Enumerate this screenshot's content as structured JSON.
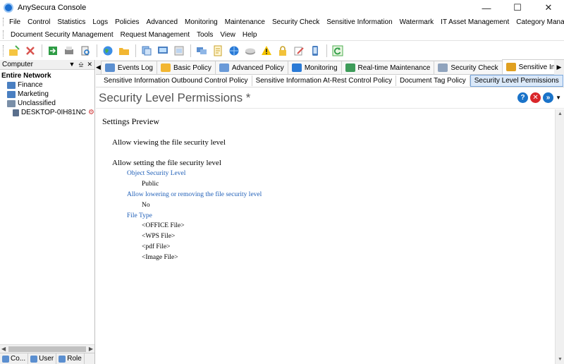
{
  "window": {
    "title": "AnySecura Console"
  },
  "menu": {
    "row1": [
      "File",
      "Control",
      "Statistics",
      "Logs",
      "Policies",
      "Advanced",
      "Monitoring",
      "Maintenance",
      "Security Check",
      "Sensitive Information",
      "Watermark",
      "IT Asset Management",
      "Category Management"
    ],
    "row2": [
      "Document Security Management",
      "Request Management",
      "Tools",
      "View",
      "Help"
    ]
  },
  "left_pane": {
    "header": "Computer",
    "tree": [
      {
        "label": "Entire Network",
        "bold": true,
        "indent": 0
      },
      {
        "label": "Finance",
        "indent": 1
      },
      {
        "label": "Marketing",
        "indent": 1
      },
      {
        "label": "Unclassified",
        "indent": 1
      },
      {
        "label": "DESKTOP-0IH81NC",
        "indent": 2
      }
    ],
    "bottom_tabs": [
      "Co...",
      "User",
      "Role"
    ]
  },
  "tabs": [
    "Events Log",
    "Basic Policy",
    "Advanced Policy",
    "Monitoring",
    "Real-time Maintenance",
    "Security Check",
    "Sensitive Inform..."
  ],
  "subtabs": [
    "Sensitive Information Outbound Control Policy",
    "Sensitive Information At-Rest Control Policy",
    "Document Tag Policy",
    "Security Level Permissions"
  ],
  "page": {
    "title": "Security Level Permissions *",
    "preview_title": "Settings Preview",
    "allow_viewing": "Allow viewing the file security level",
    "allow_setting": "Allow setting the file security level",
    "object_level_label": "Object Security Level",
    "object_level_value": "Public",
    "lowering_label": "Allow lowering or removing the file security level",
    "lowering_value": "No",
    "file_type_label": "File Type",
    "file_types": [
      "<OFFICE File>",
      "<WPS File>",
      "<pdf File>",
      "<Image File>"
    ]
  },
  "colors": {
    "accent": "#1a73c9",
    "link_blue": "#1f5fb8",
    "active_subtab": "#dbe9f9"
  }
}
